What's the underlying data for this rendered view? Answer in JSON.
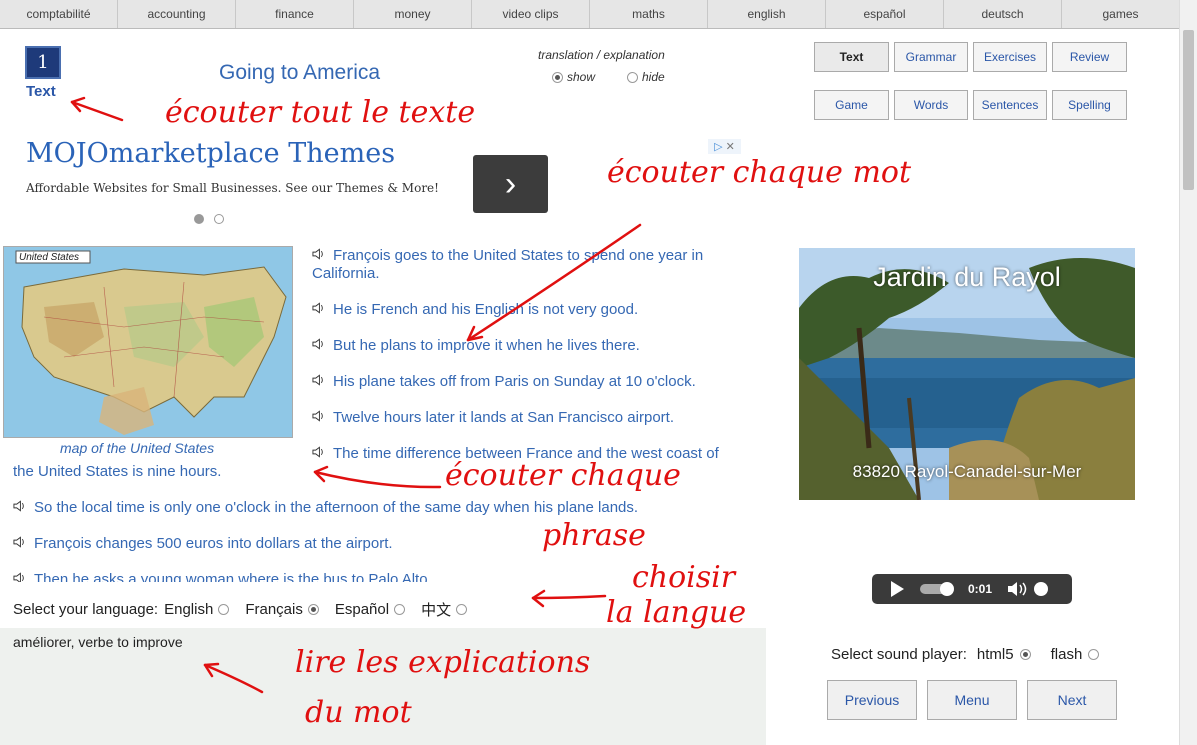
{
  "topnav": [
    "comptabilité",
    "accounting",
    "finance",
    "money",
    "video clips",
    "maths",
    "english",
    "español",
    "deutsch",
    "games"
  ],
  "lesson": {
    "number": "1",
    "label": "Text",
    "title": "Going to America"
  },
  "translation": {
    "title": "translation / explanation",
    "show": "show",
    "hide": "hide",
    "selected": "show"
  },
  "tabs": {
    "row1": [
      "Text",
      "Grammar",
      "Exercises",
      "Review"
    ],
    "row2": [
      "Game",
      "Words",
      "Sentences",
      "Spelling"
    ],
    "active": "Text"
  },
  "ad": {
    "title": "MOJOmarketplace Themes",
    "subtitle": "Affordable Websites for Small Businesses. See our Themes & More!",
    "next_glyph": "›"
  },
  "map": {
    "label": "United States",
    "caption": "map of the United States"
  },
  "sentences": [
    {
      "line1": "François goes to the United States to spend one year in",
      "line2": "California."
    },
    {
      "line1": "He is French and his English is not very good."
    },
    {
      "line1": "But he plans to improve it when he lives there."
    },
    {
      "line1": "His plane takes off from Paris on Sunday at 10 o'clock."
    },
    {
      "line1": "Twelve hours later it lands at San Francisco airport."
    },
    {
      "line1": "The time difference between France and the west coast of",
      "line2": "the United States is nine hours."
    },
    {
      "line1": "So the local time is only one o'clock in the afternoon of the same day when his plane lands."
    },
    {
      "line1": "François changes 500 euros into dollars at the airport."
    },
    {
      "line1": "Then he asks a young woman where is the bus to Palo Alto."
    }
  ],
  "language": {
    "label": "Select your language:",
    "options": [
      "English",
      "Français",
      "Español",
      "中文"
    ],
    "selected": "Français"
  },
  "explanation": "améliorer, verbe to improve",
  "photo": {
    "title": "Jardin du Rayol",
    "caption": "83820 Rayol-Canadel-sur-Mer"
  },
  "player": {
    "time": "0:01"
  },
  "sound": {
    "label": "Select sound player:",
    "options": [
      "html5",
      "flash"
    ],
    "selected": "html5"
  },
  "nav": {
    "previous": "Previous",
    "menu": "Menu",
    "next": "Next"
  },
  "annotations": {
    "text": "écouter tout le texte",
    "word": "écouter chaque mot",
    "sentence1": "écouter chaque",
    "sentence2": "phrase",
    "lang1": "choisir",
    "lang2": "la langue",
    "explain1": "lire les explications",
    "explain2": "du mot"
  },
  "colors": {
    "link": "#3568b3",
    "annotation": "#e01010",
    "lesson_box": "#1e3a7a"
  }
}
